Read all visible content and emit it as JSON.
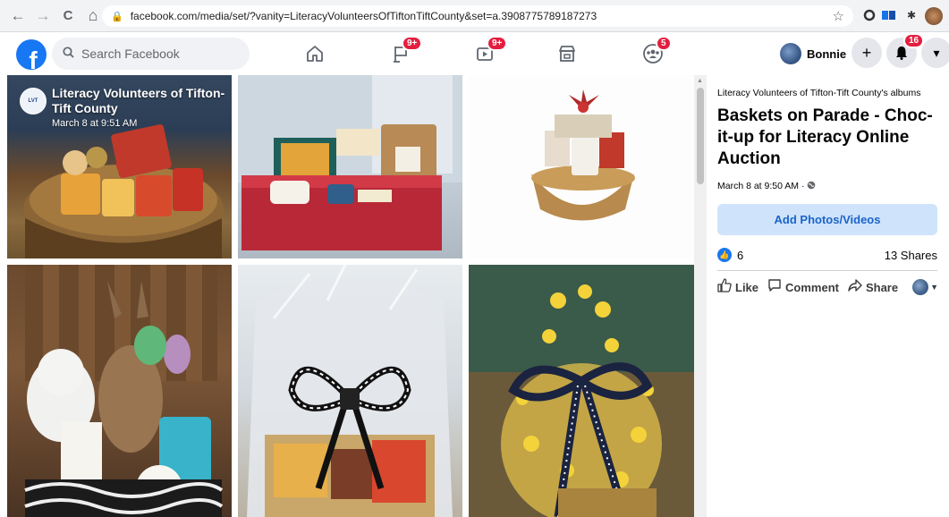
{
  "browser": {
    "url": "facebook.com/media/set/?vanity=LiteracyVolunteersOfTiftonTiftCounty&set=a.3908775789187273",
    "back": "←",
    "forward": "→",
    "reload": "C",
    "home": "⌂",
    "star": "☆"
  },
  "header": {
    "logo": "f",
    "search_placeholder": "Search Facebook",
    "nav": [
      {
        "name": "home",
        "badge": ""
      },
      {
        "name": "pages",
        "badge": "9+"
      },
      {
        "name": "watch",
        "badge": "9+"
      },
      {
        "name": "marketplace",
        "badge": ""
      },
      {
        "name": "groups",
        "badge": "5"
      }
    ],
    "profile_name": "Bonnie",
    "create_label": "+",
    "notifications_badge": "16",
    "account_label": "▾"
  },
  "album": {
    "page_name": "Literacy Volunteers of Tifton-Tift County",
    "photo_date": "March 8 at 9:51 AM",
    "owner_albums": "Literacy Volunteers of Tifton-Tift County's albums",
    "title": "Baskets on Parade - Choc-it-up for Literacy Online Auction",
    "date": "March 8 at 9:50 AM · ",
    "add_button": "Add Photos/Videos",
    "reactions_count": "6",
    "shares": "13 Shares",
    "actions": {
      "like": "Like",
      "comment": "Comment",
      "share": "Share"
    }
  }
}
